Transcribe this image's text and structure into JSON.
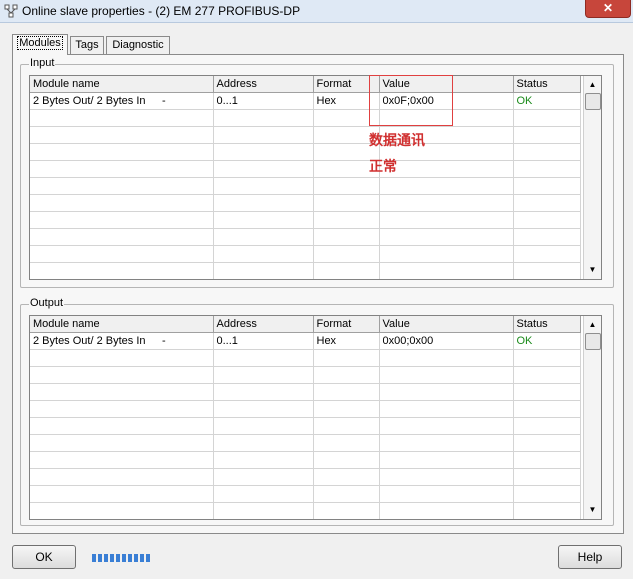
{
  "window": {
    "title": "Online slave properties - (2) EM 277 PROFIBUS-DP",
    "close_glyph": "✕"
  },
  "tabs": [
    {
      "label": "Modules",
      "active": true
    },
    {
      "label": "Tags",
      "active": false
    },
    {
      "label": "Diagnostic",
      "active": false
    }
  ],
  "input": {
    "label": "Input",
    "columns": [
      "Module name",
      "Address",
      "Format",
      "Value",
      "Status"
    ],
    "rows": [
      {
        "module_name": "2 Bytes Out/ 2 Bytes In",
        "dash": "-",
        "address": "0...1",
        "format": "Hex",
        "value": "0x0F;0x00",
        "status": "OK"
      }
    ]
  },
  "output": {
    "label": "Output",
    "columns": [
      "Module name",
      "Address",
      "Format",
      "Value",
      "Status"
    ],
    "rows": [
      {
        "module_name": "2 Bytes Out/ 2 Bytes In",
        "dash": "-",
        "address": "0...1",
        "format": "Hex",
        "value": "0x00;0x00",
        "status": "OK"
      }
    ]
  },
  "annotation": {
    "line1": "数据通讯",
    "line2": "正常",
    "color": "#d03030"
  },
  "buttons": {
    "ok": "OK",
    "help": "Help"
  },
  "scrollbar": {
    "up": "▲",
    "down": "▼"
  },
  "colors": {
    "status_ok": "#1a8a1a",
    "progress": "#3a7fd5"
  }
}
